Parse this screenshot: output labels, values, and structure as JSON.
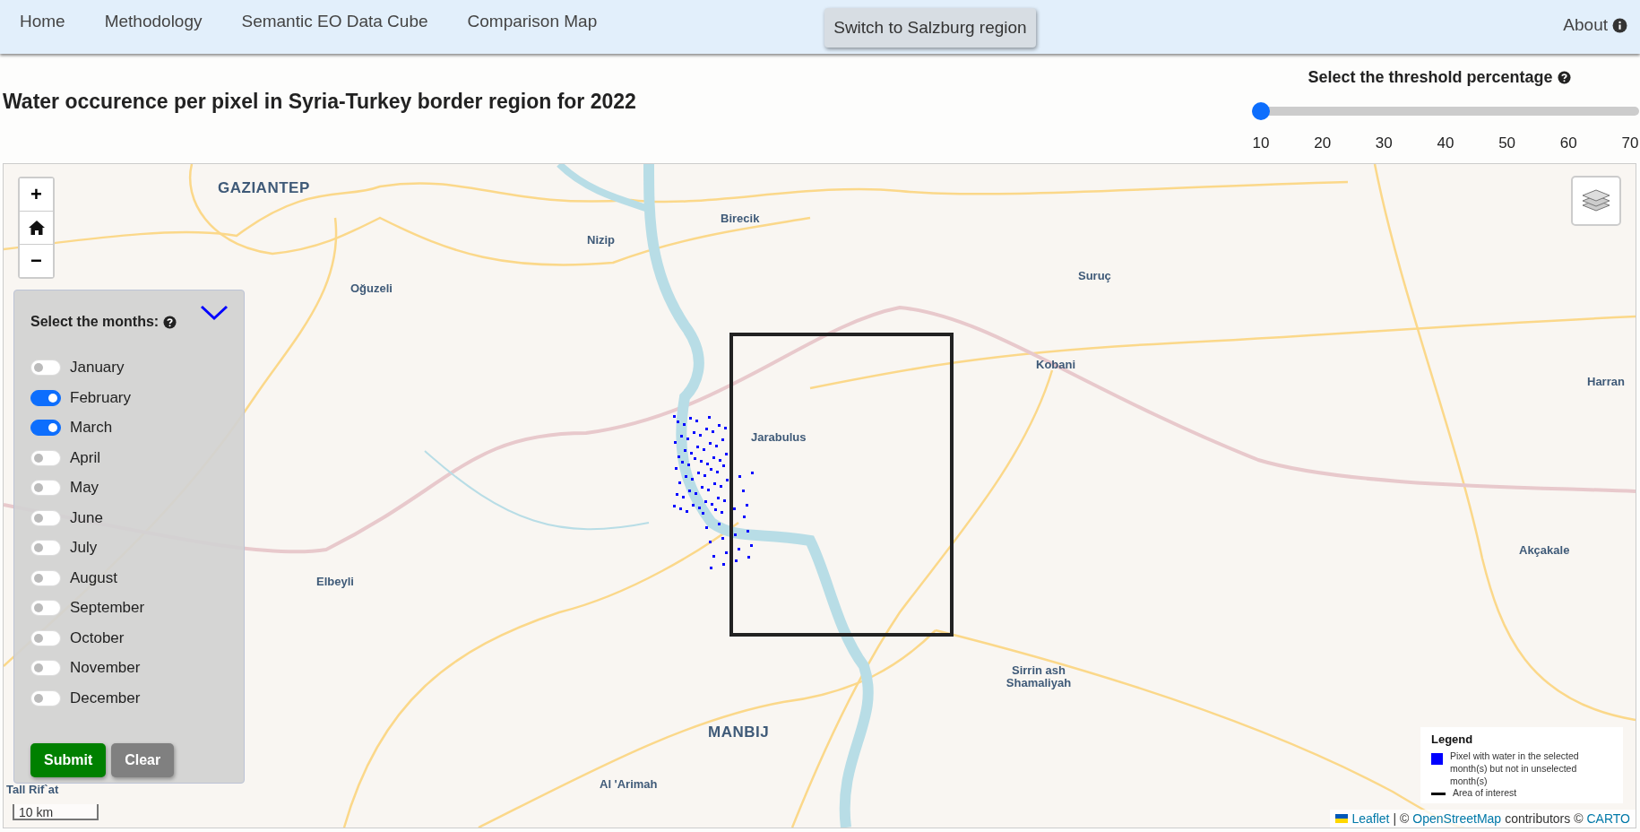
{
  "nav": {
    "links": [
      {
        "label": "Home"
      },
      {
        "label": "Methodology"
      },
      {
        "label": "Semantic EO Data Cube"
      },
      {
        "label": "Comparison Map"
      }
    ],
    "region_button": "Switch to Salzburg region",
    "about": "About"
  },
  "title": "Water occurence per pixel in Syria-Turkey border region for 2022",
  "threshold": {
    "label": "Select the threshold percentage",
    "level": 0,
    "ticks": [
      "10",
      "20",
      "30",
      "40",
      "50",
      "60",
      "70"
    ]
  },
  "map": {
    "zoom_in": "+",
    "zoom_out": "−",
    "places": [
      {
        "name": "GAZIANTEP",
        "kind": "city"
      },
      {
        "name": "Birecik",
        "kind": "town"
      },
      {
        "name": "Nizip",
        "kind": "town"
      },
      {
        "name": "Oğuzeli",
        "kind": "town"
      },
      {
        "name": "Suruç",
        "kind": "town"
      },
      {
        "name": "Kobani",
        "kind": "town"
      },
      {
        "name": "Harran",
        "kind": "town"
      },
      {
        "name": "Jarabulus",
        "kind": "town"
      },
      {
        "name": "Akçakale",
        "kind": "town"
      },
      {
        "name": "Elbeyli",
        "kind": "town"
      },
      {
        "name": "Sirrin ash Shamaliyah",
        "kind": "town"
      },
      {
        "name": "MANBIJ",
        "kind": "city"
      },
      {
        "name": "Al 'Arimah",
        "kind": "town"
      },
      {
        "name": "Tall Rif`at",
        "kind": "town"
      }
    ],
    "scale": "10 km",
    "legend": {
      "title": "Legend",
      "items": [
        {
          "kind": "fill",
          "color": "#0000ff",
          "label": "Pixel with water in the selected month(s) but not in unselected month(s)"
        },
        {
          "kind": "line",
          "color": "#000000",
          "label": "Area of interest"
        }
      ]
    },
    "attribution": {
      "leaflet": "Leaflet",
      "sep": "| ©",
      "osm": "OpenStreetMap",
      "contributors": "contributors ©",
      "carto": "CARTO"
    }
  },
  "months_panel": {
    "title": "Select the months:",
    "months": [
      {
        "label": "January",
        "on": false
      },
      {
        "label": "February",
        "on": true
      },
      {
        "label": "March",
        "on": true
      },
      {
        "label": "April",
        "on": false
      },
      {
        "label": "May",
        "on": false
      },
      {
        "label": "June",
        "on": false
      },
      {
        "label": "July",
        "on": false
      },
      {
        "label": "August",
        "on": false
      },
      {
        "label": "September",
        "on": false
      },
      {
        "label": "October",
        "on": false
      },
      {
        "label": "November",
        "on": false
      },
      {
        "label": "December",
        "on": false
      }
    ],
    "buttons": [
      {
        "label": "Submit",
        "kind": "primary"
      },
      {
        "label": "Clear",
        "kind": "secondary"
      }
    ]
  }
}
